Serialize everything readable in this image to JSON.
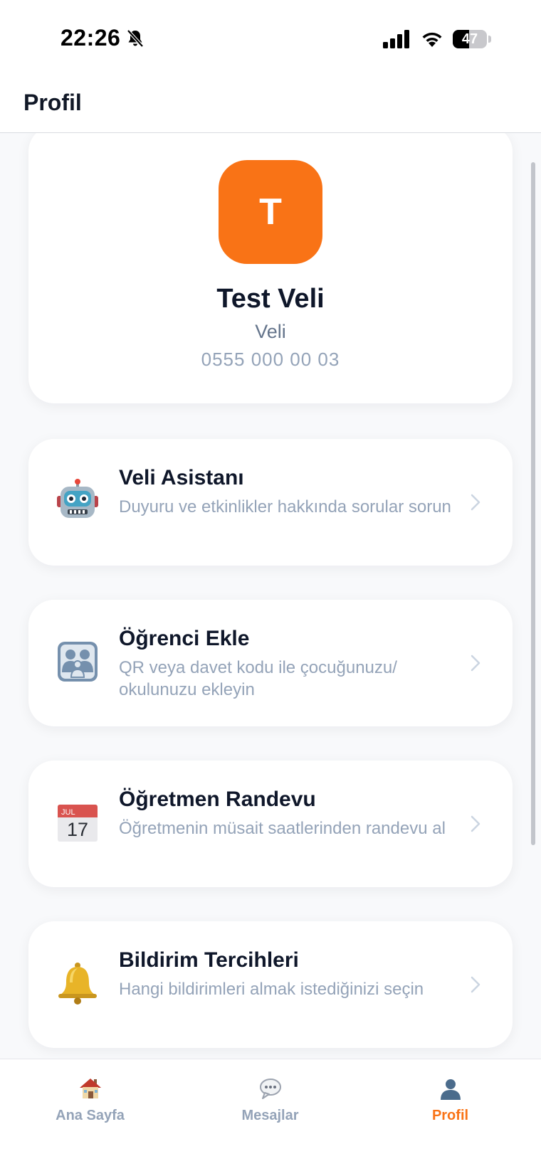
{
  "status_bar": {
    "time": "22:26",
    "battery": "47",
    "battery_level": 0.47,
    "icons": [
      "bell-off-icon",
      "signal-icon",
      "wifi-icon",
      "battery-icon"
    ]
  },
  "header": {
    "title": "Profil"
  },
  "profile": {
    "avatar_letter": "T",
    "avatar_color": "#f97316",
    "name": "Test Veli",
    "role": "Veli",
    "phone": "0555 000 00 03"
  },
  "menu": {
    "items": [
      {
        "icon": "robot-icon",
        "title": "Veli Asistanı",
        "description": "Duyuru ve etkinlikler hakkında sorular sorun"
      },
      {
        "icon": "family-icon",
        "title": "Öğrenci Ekle",
        "description": "QR veya davet kodu ile çocuğunuzu/ okulunuzu ekleyin"
      },
      {
        "icon": "calendar-icon",
        "title": "Öğretmen Randevu",
        "description": "Öğretmenin müsait saatlerinden randevu al"
      },
      {
        "icon": "bell-icon",
        "title": "Bildirim Tercihleri",
        "description": "Hangi bildirimleri almak istediğinizi seçin"
      }
    ]
  },
  "calendar_icon": {
    "month": "JUL",
    "day": "17"
  },
  "tab_bar": {
    "tabs": [
      {
        "icon": "house-icon",
        "label": "Ana Sayfa",
        "active": false
      },
      {
        "icon": "speech-bubble-icon",
        "label": "Mesajlar",
        "active": false
      },
      {
        "icon": "person-icon",
        "label": "Profil",
        "active": true
      }
    ],
    "active_color": "#f97316",
    "inactive_color": "#94a3b8"
  }
}
